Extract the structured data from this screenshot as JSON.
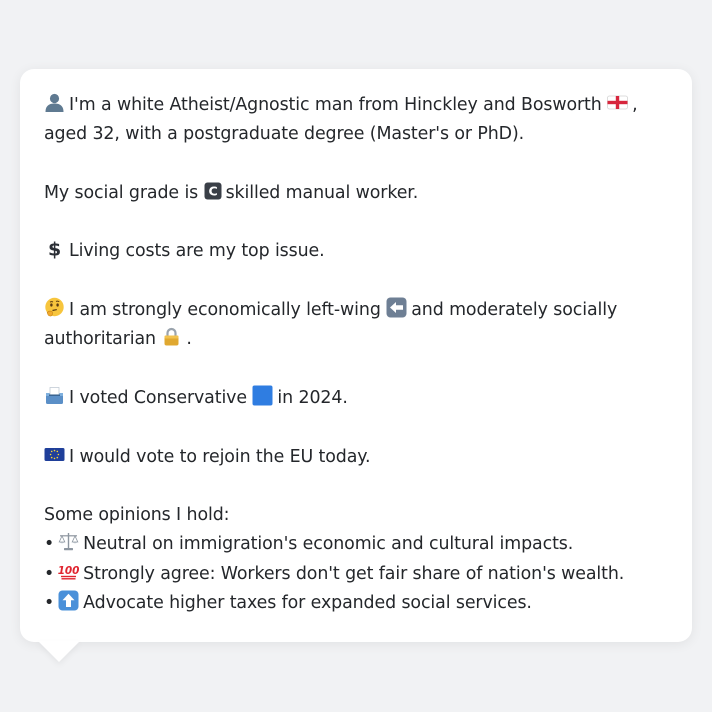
{
  "intro": {
    "prefix": "I'm a white Atheist/Agnostic man from Hinckley and Bosworth",
    "suffix": ", aged 32, with a postgraduate degree (Master's or PhD)."
  },
  "social_grade": {
    "prefix": "My social grade is",
    "suffix": "skilled manual worker."
  },
  "top_issue": "Living costs are my top issue.",
  "ideology": {
    "part1": "I am strongly economically left-wing",
    "part2": "and moderately socially authoritarian",
    "end": "."
  },
  "vote": {
    "prefix": "I voted Conservative",
    "suffix": "in 2024."
  },
  "eu": "I would vote to rejoin the EU today.",
  "opinions": {
    "heading": "Some opinions I hold:",
    "bullet": "•",
    "items": [
      {
        "icon": "balance-scale-icon",
        "text": "Neutral on immigration's economic and cultural impacts."
      },
      {
        "icon": "hundred-points-icon",
        "text": "Strongly agree: Workers don't get fair share of nation's wealth."
      },
      {
        "icon": "up-arrow-icon",
        "text": "Advocate higher taxes for expanded social services."
      }
    ]
  },
  "icons": {
    "person": "person-silhouette-icon",
    "england_flag": "england-flag-icon",
    "grade_c": "letter-c-icon",
    "dollar": "dollar-sign-icon",
    "thinking": "thinking-face-icon",
    "left_arrow": "left-arrow-icon",
    "lock": "lock-icon",
    "ballot": "ballot-box-icon",
    "blue_square": "blue-square-icon",
    "eu_flag": "eu-flag-icon"
  },
  "colors": {
    "background": "#f1f2f4",
    "bubble": "#ffffff",
    "text": "#24272b",
    "conservative_blue": "#2f7de1"
  }
}
